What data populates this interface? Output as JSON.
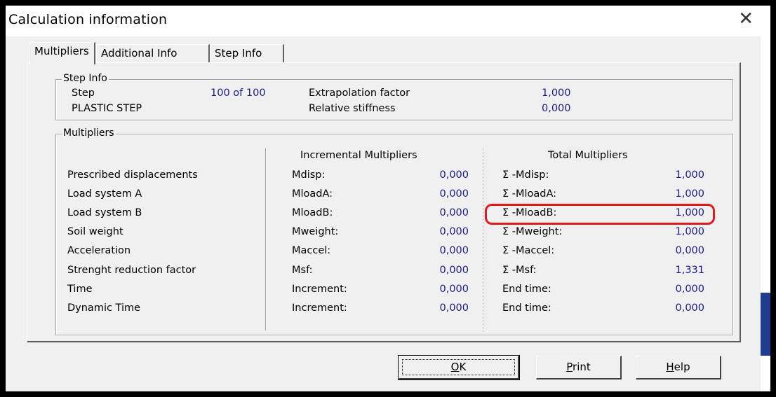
{
  "window": {
    "title": "Calculation information",
    "close_glyph": "✕"
  },
  "tabs": [
    {
      "label": "Multipliers",
      "active": true
    },
    {
      "label": "Additional Info",
      "active": false
    },
    {
      "label": "Step Info",
      "active": false
    }
  ],
  "step_info": {
    "legend": "Step Info",
    "step_label": "Step",
    "step_value": "100 of 100",
    "phase_label": "PLASTIC STEP",
    "extrapolation_label": "Extrapolation factor",
    "extrapolation_value": "1,000",
    "stiffness_label": "Relative stiffness",
    "stiffness_value": "0,000"
  },
  "multipliers": {
    "legend": "Multipliers",
    "incremental_header": "Incremental Multipliers",
    "total_header": "Total Multipliers",
    "rows": [
      {
        "label": "Prescribed displacements",
        "inc_name": "Mdisp:",
        "inc_value": "0,000",
        "total_name": "Σ -Mdisp:",
        "total_value": "1,000"
      },
      {
        "label": "Load system A",
        "inc_name": "MloadA:",
        "inc_value": "0,000",
        "total_name": "Σ -MloadA:",
        "total_value": "1,000"
      },
      {
        "label": "Load system B",
        "inc_name": "MloadB:",
        "inc_value": "0,000",
        "total_name": "Σ -MloadB:",
        "total_value": "1,000"
      },
      {
        "label": "Soil weight",
        "inc_name": "Mweight:",
        "inc_value": "0,000",
        "total_name": "Σ -Mweight:",
        "total_value": "1,000"
      },
      {
        "label": "Acceleration",
        "inc_name": "Maccel:",
        "inc_value": "0,000",
        "total_name": "Σ -Maccel:",
        "total_value": "0,000"
      },
      {
        "label": "Strenght reduction factor",
        "inc_name": "Msf:",
        "inc_value": "0,000",
        "total_name": "Σ -Msf:",
        "total_value": "1,331"
      },
      {
        "label": "Time",
        "inc_name": "Increment:",
        "inc_value": "0,000",
        "total_name": "End time:",
        "total_value": "0,000"
      },
      {
        "label": "Dynamic Time",
        "inc_name": "Increment:",
        "inc_value": "0,000",
        "total_name": "End time:",
        "total_value": "0,000"
      }
    ]
  },
  "buttons": {
    "ok": {
      "mnemonic": "O",
      "rest": "K"
    },
    "print": {
      "mnemonic": "P",
      "rest": "rint"
    },
    "help": {
      "mnemonic": "H",
      "rest": "elp"
    }
  },
  "colors": {
    "highlight": "#e01b1b",
    "value_text": "#1a1a8a"
  }
}
